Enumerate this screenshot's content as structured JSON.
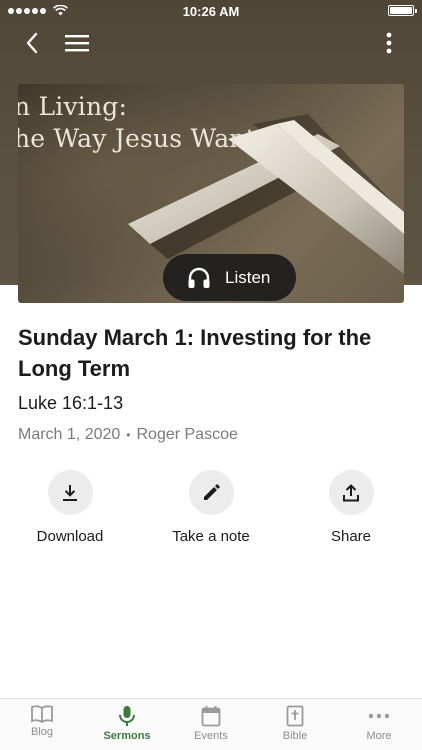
{
  "status_bar": {
    "time": "10:26 AM"
  },
  "banner": {
    "line1": "n Living:",
    "line2": "he Way Jesus Wants",
    "listen_label": "Listen"
  },
  "sermon": {
    "title": "Sunday March 1: Investing for the Long Term",
    "scripture": "Luke 16:1-13",
    "date": "March 1, 2020",
    "separator": "•",
    "speaker": "Roger Pascoe"
  },
  "actions": [
    {
      "label": "Download",
      "icon": "download-icon"
    },
    {
      "label": "Take a note",
      "icon": "pencil-icon"
    },
    {
      "label": "Share",
      "icon": "share-icon"
    }
  ],
  "tabs": [
    {
      "label": "Blog",
      "icon": "book-icon",
      "active": false
    },
    {
      "label": "Sermons",
      "icon": "microphone-icon",
      "active": true
    },
    {
      "label": "Events",
      "icon": "calendar-icon",
      "active": false
    },
    {
      "label": "Bible",
      "icon": "bible-icon",
      "active": false
    },
    {
      "label": "More",
      "icon": "more-dots-icon",
      "active": false
    }
  ],
  "colors": {
    "header": "#4f4637",
    "accent": "#3d7a3f",
    "inactive_tab": "#8c8c8c"
  }
}
